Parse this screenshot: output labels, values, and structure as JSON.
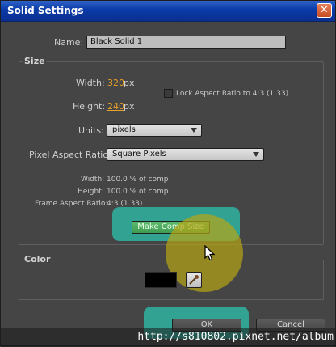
{
  "window": {
    "title": "Solid Settings",
    "close_glyph": "✕"
  },
  "name_field": {
    "label": "Name:",
    "value": "Black Solid 1"
  },
  "size": {
    "section_title": "Size",
    "width_label": "Width:",
    "width_value": "320",
    "width_unit": "px",
    "height_label": "Height:",
    "height_value": "240",
    "height_unit": "px",
    "lock_aspect_label": "Lock Aspect Ratio to 4:3 (1.33)",
    "units_label": "Units:",
    "units_value": "pixels",
    "par_label": "Pixel Aspect Ratio:",
    "par_value": "Square Pixels",
    "info": {
      "width_label": "Width:",
      "width_value": "100.0 % of comp",
      "height_label": "Height:",
      "height_value": "100.0 % of comp",
      "far_label": "Frame Aspect Ratio:",
      "far_value": "4:3 (1.33)"
    },
    "make_comp_size_label": "Make Comp Size"
  },
  "color": {
    "section_title": "Color",
    "swatch_color": "#000000"
  },
  "buttons": {
    "ok_label": "OK",
    "cancel_label": "Cancel"
  },
  "watermark": {
    "text": "http://s810802.pixnet.net/album"
  },
  "colors": {
    "accent_value": "#e7a12a",
    "highlight_teal": "#2fb3a0",
    "cursor_halo": "#b7a516",
    "titlebar": "#0a3aa8"
  }
}
